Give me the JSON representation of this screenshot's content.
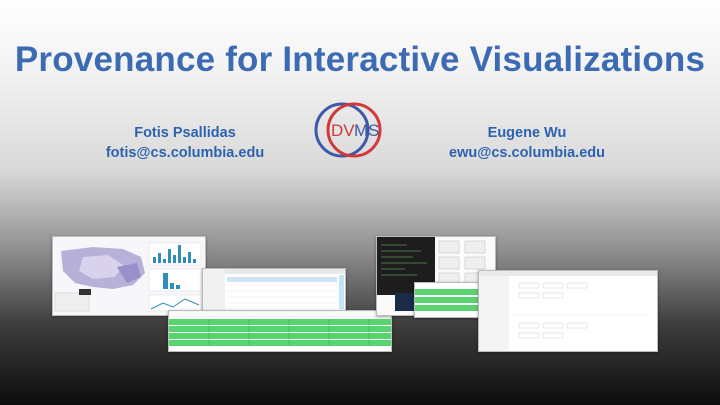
{
  "slide": {
    "title": "Provenance for Interactive Visualizations",
    "authors": [
      {
        "name": "Fotis Psallidas",
        "email": "fotis@cs.columbia.edu"
      },
      {
        "name": "Eugene Wu",
        "email": "ewu@cs.columbia.edu"
      }
    ],
    "logo": {
      "text_d": "DV",
      "text_ms": "MS",
      "colors": {
        "blue": "#3d5aa8",
        "red": "#d03a3a"
      }
    }
  }
}
